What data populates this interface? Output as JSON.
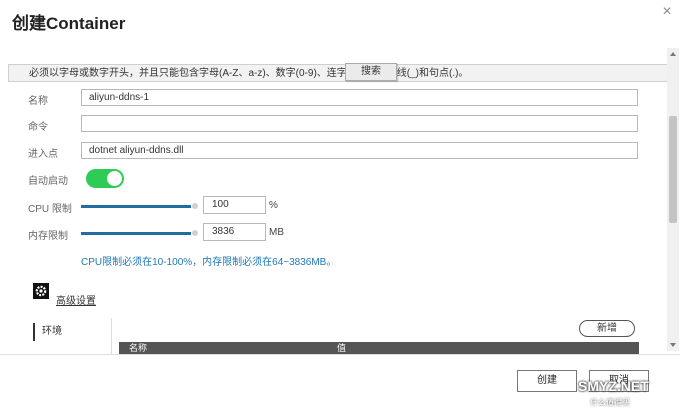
{
  "dialog": {
    "title": "创建Container",
    "close_glyph": "×"
  },
  "hint": {
    "text": "必须以字母或数字开头，并且只能包含字母(A-Z、a-z)、数字(0-9)、连字符(-)、下划线(_)和句点(.)。",
    "search_label": "搜索"
  },
  "form": {
    "name_label": "名称",
    "name_value": "aliyun-ddns-1",
    "command_label": "命令",
    "command_value": "",
    "entrypoint_label": "进入点",
    "entrypoint_value": "dotnet aliyun-ddns.dll",
    "autostart_label": "自动启动",
    "autostart_on": true,
    "cpu_label": "CPU 限制",
    "cpu_value": "100",
    "cpu_unit": "%",
    "mem_label": "内存限制",
    "mem_value": "3836",
    "mem_unit": "MB",
    "limit_note": "CPU限制必须在10-100%，内存限制必须在64~3836MB。"
  },
  "advanced": {
    "link_label": "高级设置",
    "icon": "gear-icon"
  },
  "env": {
    "tab_label": "环境",
    "new_label": "新增",
    "columns": [
      "名称",
      "值"
    ]
  },
  "footer": {
    "create_label": "创建",
    "cancel_label": "取消"
  },
  "watermark": {
    "main": "SMYZ.NET",
    "sub": "什么值得买"
  },
  "colors": {
    "accent": "#1f6ea0",
    "toggle_on": "#2ecc57",
    "note": "#1f78b4"
  }
}
